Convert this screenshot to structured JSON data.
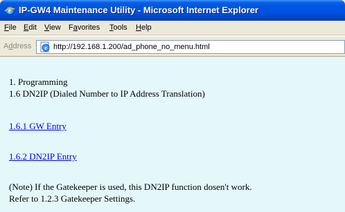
{
  "window": {
    "title": "IP-GW4 Maintenance Utility - Microsoft Internet Explorer",
    "icon": "ie-icon"
  },
  "menubar": {
    "items": [
      {
        "first": "F",
        "rest": "ile"
      },
      {
        "first": "E",
        "rest": "dit"
      },
      {
        "first": "V",
        "rest": "iew"
      },
      {
        "first": "F",
        "rest": "avorites",
        "pre": "",
        "u_index": 1
      },
      {
        "first": "T",
        "rest": "ools"
      },
      {
        "first": "H",
        "rest": "elp"
      }
    ],
    "favorites_prefix": "F",
    "favorites_u": "a",
    "favorites_suffix": "vorites"
  },
  "addressbar": {
    "label_first": "A",
    "label_u": "d",
    "label_rest": "dress",
    "url": "http://192.168.1.200/ad_phone_no_menu.html"
  },
  "content": {
    "heading_line1": "1. Programming",
    "heading_line2": "1.6 DN2IP (Dialed Number to IP Address Translation)",
    "link_gw_entry": "1.6.1 GW Entry",
    "link_dn2ip_entry": "1.6.2 DN2IP Entry",
    "note_line1": "(Note) If the Gatekeeper is used, this DN2IP function dosen't work.",
    "note_line2": "Refer to 1.2.3 Gatekeeper Settings."
  },
  "colors": {
    "titlebar": "#0055e5",
    "content_bg": "#e4f7fb",
    "link": "#0000ee"
  }
}
